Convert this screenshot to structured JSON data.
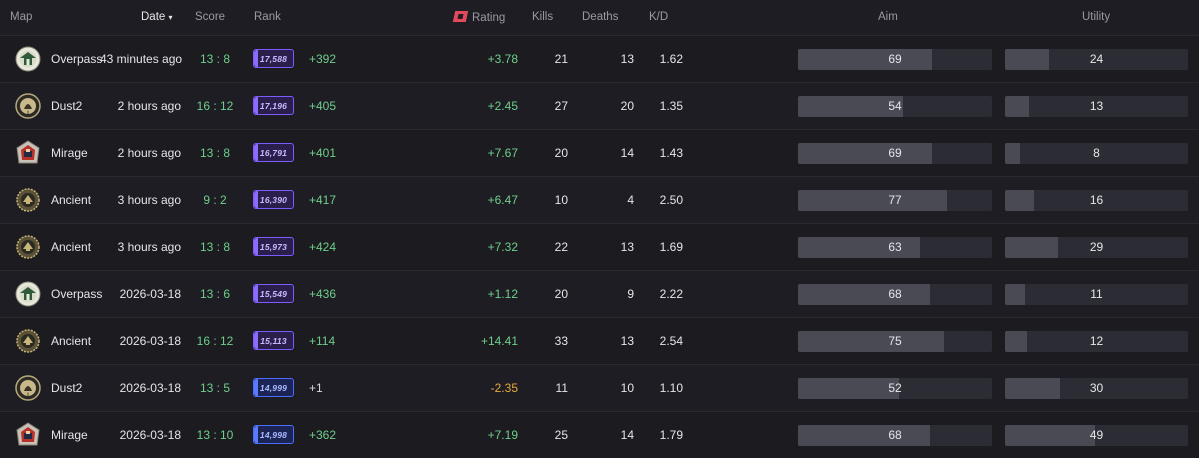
{
  "header": {
    "map": "Map",
    "date": "Date",
    "date_sort_icon": "chevron-down-icon",
    "score": "Score",
    "rank": "Rank",
    "rating": "Rating",
    "kills": "Kills",
    "deaths": "Deaths",
    "kd": "K/D",
    "aim": "Aim",
    "utility": "Utility"
  },
  "colors": {
    "positive": "#6fcf8c",
    "negative": "#e8a93b",
    "rank_purple": "#7b5cff",
    "rank_blue": "#4c6dff",
    "rating_logo": "#e24a5b"
  },
  "rows": [
    {
      "map": "Overpass",
      "icon": "overpass-map-icon",
      "date": "43 minutes ago",
      "score": "13 : 8",
      "rank": "17,588",
      "rank_tier": "purple",
      "rank_delta": "+392",
      "rating": "+3.78",
      "kills": "21",
      "deaths": "13",
      "kd": "1.62",
      "aim": 69,
      "utility": 24
    },
    {
      "map": "Dust2",
      "icon": "dust2-map-icon",
      "date": "2 hours ago",
      "score": "16 : 12",
      "rank": "17,196",
      "rank_tier": "purple",
      "rank_delta": "+405",
      "rating": "+2.45",
      "kills": "27",
      "deaths": "20",
      "kd": "1.35",
      "aim": 54,
      "utility": 13
    },
    {
      "map": "Mirage",
      "icon": "mirage-map-icon",
      "date": "2 hours ago",
      "score": "13 : 8",
      "rank": "16,791",
      "rank_tier": "purple",
      "rank_delta": "+401",
      "rating": "+7.67",
      "kills": "20",
      "deaths": "14",
      "kd": "1.43",
      "aim": 69,
      "utility": 8
    },
    {
      "map": "Ancient",
      "icon": "ancient-map-icon",
      "date": "3 hours ago",
      "score": "9 : 2",
      "rank": "16,390",
      "rank_tier": "purple",
      "rank_delta": "+417",
      "rating": "+6.47",
      "kills": "10",
      "deaths": "4",
      "kd": "2.50",
      "aim": 77,
      "utility": 16
    },
    {
      "map": "Ancient",
      "icon": "ancient-map-icon",
      "date": "3 hours ago",
      "score": "13 : 8",
      "rank": "15,973",
      "rank_tier": "purple",
      "rank_delta": "+424",
      "rating": "+7.32",
      "kills": "22",
      "deaths": "13",
      "kd": "1.69",
      "aim": 63,
      "utility": 29
    },
    {
      "map": "Overpass",
      "icon": "overpass-map-icon",
      "date": "2026-03-18",
      "score": "13 : 6",
      "rank": "15,549",
      "rank_tier": "purple",
      "rank_delta": "+436",
      "rating": "+1.12",
      "kills": "20",
      "deaths": "9",
      "kd": "2.22",
      "aim": 68,
      "utility": 11
    },
    {
      "map": "Ancient",
      "icon": "ancient-map-icon",
      "date": "2026-03-18",
      "score": "16 : 12",
      "rank": "15,113",
      "rank_tier": "purple",
      "rank_delta": "+114",
      "rating": "+14.41",
      "kills": "33",
      "deaths": "13",
      "kd": "2.54",
      "aim": 75,
      "utility": 12
    },
    {
      "map": "Dust2",
      "icon": "dust2-map-icon",
      "date": "2026-03-18",
      "score": "13 : 5",
      "rank": "14,999",
      "rank_tier": "blue",
      "rank_delta": "+1",
      "rating": "-2.35",
      "kills": "11",
      "deaths": "10",
      "kd": "1.10",
      "aim": 52,
      "utility": 30
    },
    {
      "map": "Mirage",
      "icon": "mirage-map-icon",
      "date": "2026-03-18",
      "score": "13 : 10",
      "rank": "14,998",
      "rank_tier": "blue",
      "rank_delta": "+362",
      "rating": "+7.19",
      "kills": "25",
      "deaths": "14",
      "kd": "1.79",
      "aim": 68,
      "utility": 49
    }
  ]
}
